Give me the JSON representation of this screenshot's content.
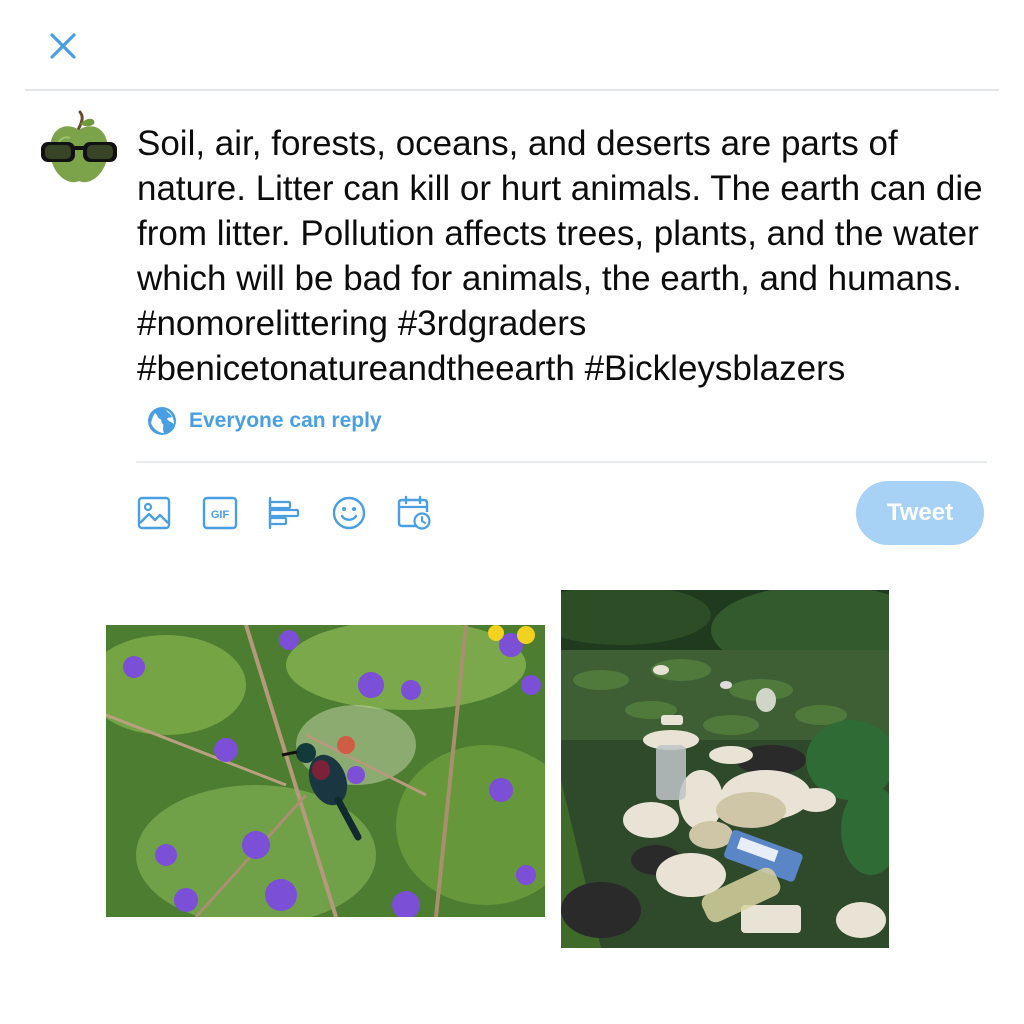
{
  "composer": {
    "close_icon": "close-icon",
    "avatar_icon": "apple-with-glasses-avatar",
    "text": "Soil, air, forests, oceans, and deserts are parts of nature. Litter can kill or hurt animals. The earth can die from litter. Pollution affects trees, plants, and the water which will be bad for animals, the earth, and humans. #nomorelittering #3rdgraders #benicetonatureandtheearth #Bickleysblazers",
    "reply_setting": {
      "icon": "globe-icon",
      "label": "Everyone can reply"
    },
    "toolbar": {
      "icons": [
        "image-icon",
        "gif-icon",
        "poll-icon",
        "emoji-icon",
        "schedule-icon"
      ],
      "gif_label": "GIF",
      "tweet_label": "Tweet"
    }
  },
  "attachments": [
    {
      "icon": "photo-bird-flowers"
    },
    {
      "icon": "photo-litter-pond"
    }
  ],
  "colors": {
    "accent": "#1d9bf0",
    "tweet_button_disabled": "#a7d1f5",
    "icon_blue": "#4a9fe3"
  }
}
